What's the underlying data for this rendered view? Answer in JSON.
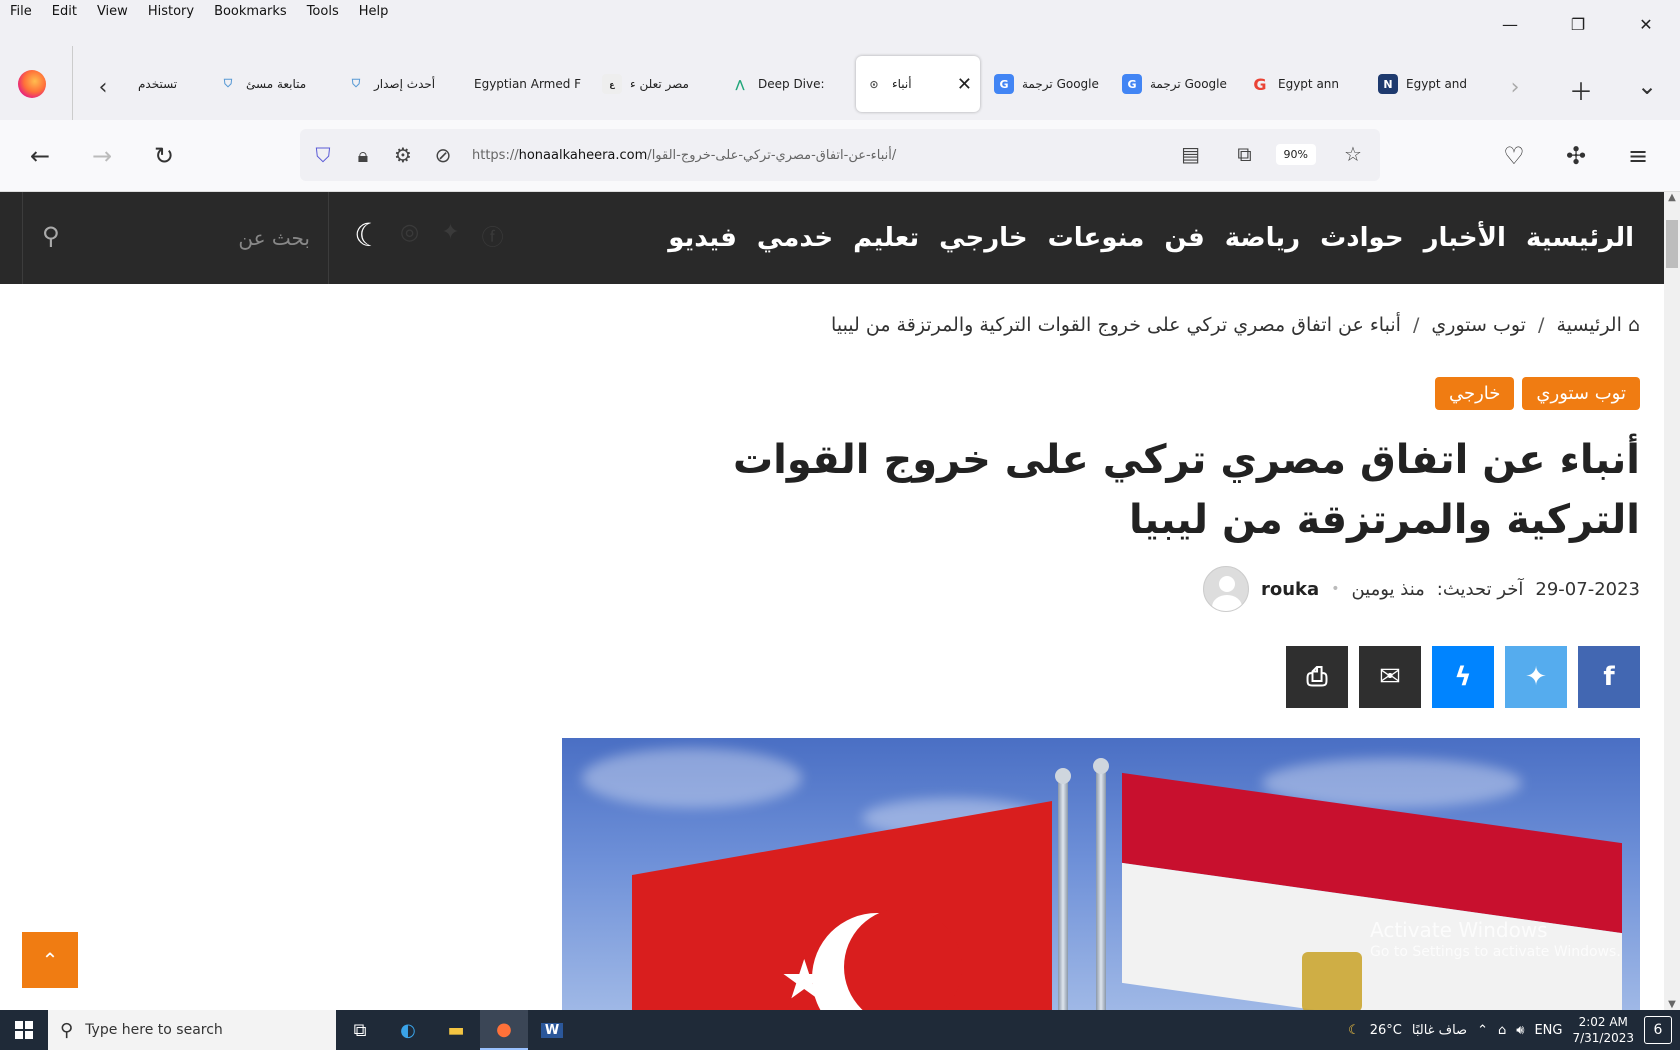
{
  "menubar": {
    "items": [
      "File",
      "Edit",
      "View",
      "History",
      "Bookmarks",
      "Tools",
      "Help"
    ]
  },
  "window_controls": {
    "minimize": "—",
    "restore": "❐",
    "close": "✕"
  },
  "tabs": [
    {
      "label": "تستخدم",
      "icon": "partial-tab"
    },
    {
      "label": "متابعة مسئ",
      "icon": "shield-icon"
    },
    {
      "label": "أحدث إصدار",
      "icon": "shield-icon"
    },
    {
      "label": "Egyptian Armed F",
      "icon": "none"
    },
    {
      "label": "مصر تعلن ء",
      "icon": "alarabiya-icon"
    },
    {
      "label": "Deep Dive:",
      "icon": "deepdive-icon"
    },
    {
      "label": "أنباء",
      "icon": "location-pin-icon",
      "active": true
    },
    {
      "label": "ترجمة Google",
      "icon": "google-translate-icon"
    },
    {
      "label": "ترجمة Google",
      "icon": "google-translate-icon"
    },
    {
      "label": "Egypt ann",
      "icon": "google-icon"
    },
    {
      "label": "Egypt and",
      "icon": "n-icon"
    }
  ],
  "navbar": {
    "url_prefix": "https://",
    "url_host": "honaalkaheera.com",
    "url_path": "/أنباء-عن-اتفاق-مصري-تركي-على-خروج-القوا/",
    "zoom": "90%"
  },
  "site": {
    "nav": [
      "الرئيسية",
      "الأخبار",
      "حوادث",
      "رياضة",
      "فن",
      "منوعات",
      "خارجي",
      "تعليم",
      "خدمي",
      "فيديو"
    ],
    "search_placeholder": "بحث عن"
  },
  "article": {
    "breadcrumb": {
      "home": "الرئيسية",
      "section": "توب ستوري",
      "current": "أنباء عن اتفاق مصري تركي على خروج القوات التركية والمرتزقة من ليبيا"
    },
    "categories": [
      "توب ستوري",
      "خارجي"
    ],
    "title": "أنباء عن اتفاق مصري تركي على خروج القوات التركية والمرتزقة من ليبيا",
    "author": "rouka",
    "posted": "منذ يومين",
    "updated_label": "آخر تحديث:",
    "updated_date": "29-07-2023"
  },
  "share": [
    {
      "name": "facebook",
      "color": "#4267b2",
      "glyph": "f"
    },
    {
      "name": "twitter",
      "color": "#55acee",
      "glyph": "🐦"
    },
    {
      "name": "messenger",
      "color": "#0084ff",
      "glyph": "⚡"
    },
    {
      "name": "email",
      "color": "#2f2f2f",
      "glyph": "✉"
    },
    {
      "name": "print",
      "color": "#2f2f2f",
      "glyph": "⎙"
    }
  ],
  "watermark": {
    "line1": "Activate Windows",
    "line2": "Go to Settings to activate Windows."
  },
  "taskbar": {
    "search_placeholder": "Type here to search",
    "weather_temp": "26°C",
    "weather_text": "صاف غالبًا",
    "lang": "ENG",
    "time": "2:02 AM",
    "date": "7/31/2023",
    "notifications": "6"
  },
  "colors": {
    "accent": "#f07c12",
    "header_bg": "#292929"
  }
}
